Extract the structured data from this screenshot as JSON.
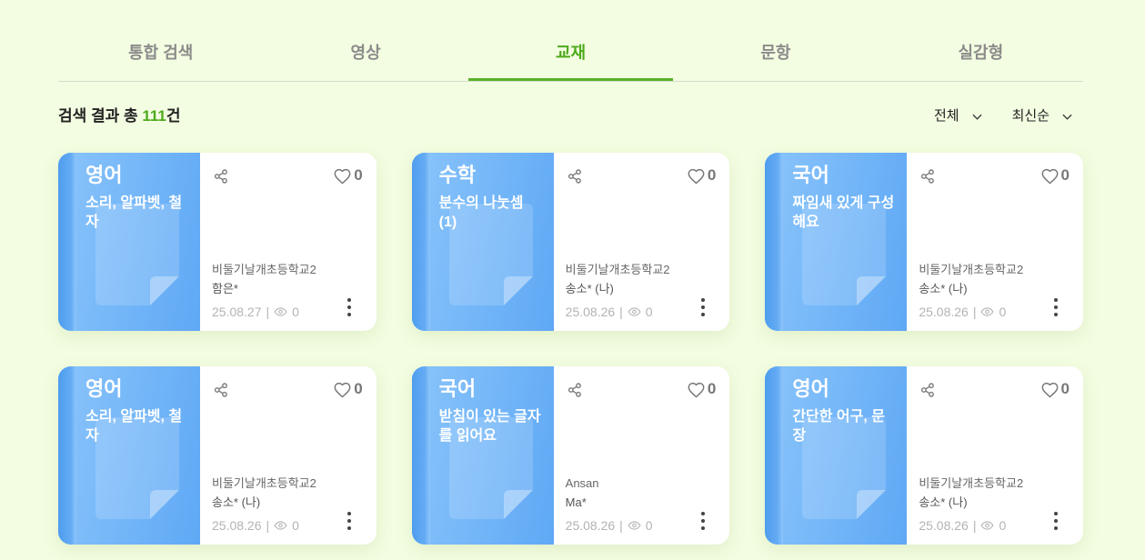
{
  "tabs": [
    {
      "label": "통합 검색",
      "active": false
    },
    {
      "label": "영상",
      "active": false
    },
    {
      "label": "교재",
      "active": true
    },
    {
      "label": "문항",
      "active": false
    },
    {
      "label": "실감형",
      "active": false
    }
  ],
  "results": {
    "prefix": "검색 결과 총 ",
    "count": 111,
    "suffix": "건"
  },
  "filters": {
    "scope": "전체",
    "sort": "최신순"
  },
  "meta_separator": "|",
  "cards": [
    {
      "subject": "영어",
      "title": "소리, 알파벳, 철자",
      "school": "비둘기날개초등학교2",
      "author": "함은*",
      "date": "25.08.27",
      "views": 0,
      "likes": 0
    },
    {
      "subject": "수학",
      "title": "분수의 나눗셈 (1)",
      "school": "비둘기날개초등학교2",
      "author": "송소* (나)",
      "date": "25.08.26",
      "views": 0,
      "likes": 0
    },
    {
      "subject": "국어",
      "title": "짜임새 있게 구성해요",
      "school": "비둘기날개초등학교2",
      "author": "송소* (나)",
      "date": "25.08.26",
      "views": 0,
      "likes": 0
    },
    {
      "subject": "영어",
      "title": "소리, 알파벳, 철자",
      "school": "비둘기날개초등학교2",
      "author": "송소* (나)",
      "date": "25.08.26",
      "views": 0,
      "likes": 0
    },
    {
      "subject": "국어",
      "title": "받침이 있는 글자를 읽어요",
      "school": "Ansan",
      "author": "Ma*",
      "date": "25.08.26",
      "views": 0,
      "likes": 0
    },
    {
      "subject": "영어",
      "title": "간단한 어구, 문장",
      "school": "비둘기날개초등학교2",
      "author": "송소* (나)",
      "date": "25.08.26",
      "views": 0,
      "likes": 0
    }
  ],
  "icons": {
    "share": "share-icon",
    "like": "heart-icon",
    "views": "eye-icon",
    "more": "more-vertical-icon",
    "dropdown": "chevron-down-icon",
    "cover_art": "page-fold-icon"
  },
  "colors": {
    "background": "#f3fde1",
    "accent": "#4eab1c",
    "accent_bar": "#59b12a",
    "cover": "#70b4f8",
    "cover_spine": "#4f9dee",
    "card": "#ffffff"
  }
}
